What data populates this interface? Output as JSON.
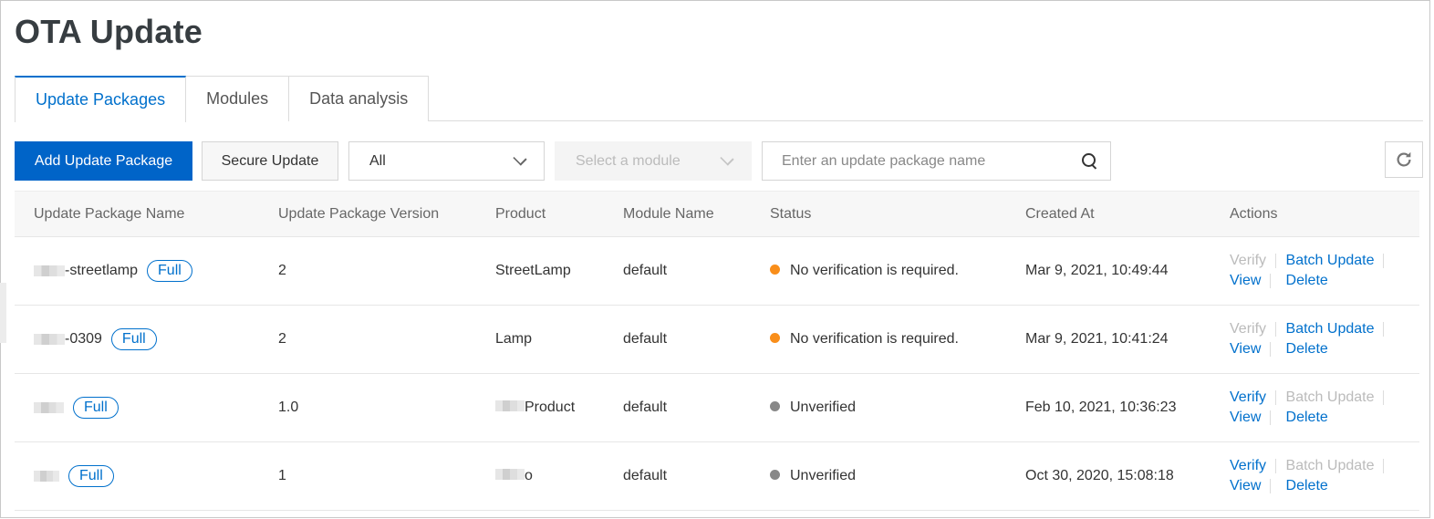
{
  "page": {
    "title": "OTA Update"
  },
  "tabs": [
    {
      "label": "Update Packages",
      "active": true
    },
    {
      "label": "Modules",
      "active": false
    },
    {
      "label": "Data analysis",
      "active": false
    }
  ],
  "toolbar": {
    "add_label": "Add Update Package",
    "secure_label": "Secure Update",
    "filter_value": "All",
    "module_placeholder": "Select a module",
    "search_placeholder": "Enter an update package name",
    "search_value": ""
  },
  "colors": {
    "primary": "#0064c8",
    "link": "#0070cc",
    "status_no_verification": "#f98e1a",
    "status_unverified": "#888888"
  },
  "table": {
    "columns": [
      "Update Package Name",
      "Update Package Version",
      "Product",
      "Module Name",
      "Status",
      "Created At",
      "Actions"
    ],
    "rows": [
      {
        "name": "-streetlamp",
        "badge": "Full",
        "version": "2",
        "product": "StreetLamp",
        "module": "default",
        "status": "No verification is required.",
        "status_color": "#f98e1a",
        "created": "Mar 9, 2021, 10:49:44",
        "actions": {
          "verify": "Verify",
          "batch": "Batch Update",
          "view": "View",
          "delete": "Delete"
        }
      },
      {
        "name": "-0309",
        "badge": "Full",
        "version": "2",
        "product": "Lamp",
        "module": "default",
        "status": "No verification is required.",
        "status_color": "#f98e1a",
        "created": "Mar 9, 2021, 10:41:24",
        "actions": {
          "verify": "Verify",
          "batch": "Batch Update",
          "view": "View",
          "delete": "Delete"
        }
      },
      {
        "name": "",
        "badge": "Full",
        "version": "1.0",
        "product": "Product",
        "module": "default",
        "status": "Unverified",
        "status_color": "#888888",
        "created": "Feb 10, 2021, 10:36:23",
        "actions": {
          "verify": "Verify",
          "batch": "Batch Update",
          "view": "View",
          "delete": "Delete"
        }
      },
      {
        "name": "",
        "badge": "Full",
        "version": "1",
        "product": "o",
        "module": "default",
        "status": "Unverified",
        "status_color": "#888888",
        "created": "Oct 30, 2020, 15:08:18",
        "actions": {
          "verify": "Verify",
          "batch": "Batch Update",
          "view": "View",
          "delete": "Delete"
        }
      }
    ]
  }
}
